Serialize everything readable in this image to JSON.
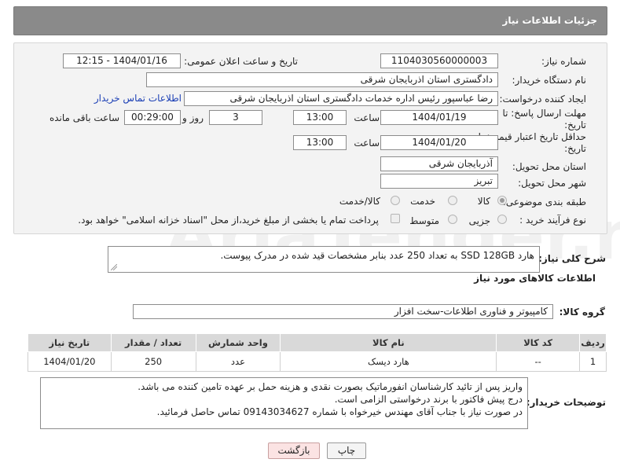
{
  "header": {
    "title": "جزئیات اطلاعات نیاز"
  },
  "form": {
    "need_number_label": "شماره نیاز:",
    "need_number": "1104030560000003",
    "announce_label": "تاریخ و ساعت اعلان عمومی:",
    "announce_value": "1404/01/16 - 12:15",
    "buyer_org_label": "نام دستگاه خریدار:",
    "buyer_org": "دادگستری استان اذربایجان شرقی",
    "creator_label": "ایجاد کننده درخواست:",
    "creator": "رضا عباسپور رئیس اداره خدمات دادگستری استان اذربایجان شرقی",
    "contact_link": "اطلاعات تماس خریدار",
    "deadline_label_1": "مهلت ارسال پاسخ: تا",
    "deadline_label_2": "تاریخ:",
    "deadline_date": "1404/01/19",
    "time_label": "ساعت",
    "deadline_time": "13:00",
    "days_value": "3",
    "days_label": "روز و",
    "remaining_time": "00:29:00",
    "remaining_label": "ساعت باقی مانده",
    "validity_label_1": "حداقل تاریخ اعتبار قیمت: تا",
    "validity_label_2": "تاریخ:",
    "validity_date": "1404/01/20",
    "validity_time": "13:00",
    "province_label": "استان محل تحویل:",
    "province": "آذربایجان شرقی",
    "city_label": "شهر محل تحویل:",
    "city": "تبریز",
    "category_label": "طبقه بندی موضوعی:",
    "category_options": [
      "کالا",
      "خدمت",
      "کالا/خدمت"
    ],
    "process_label": "نوع فرآیند خرید :",
    "process_options": [
      "جزیی",
      "متوسط"
    ],
    "payment_note": "پرداخت تمام یا بخشی از مبلغ خرید،از محل \"اسناد خزانه اسلامی\" خواهد بود."
  },
  "description": {
    "label": "شرح کلی نیاز:",
    "text": "هارد SSD 128GB به تعداد 250 عدد بنابر مشخصات قید شده در مدرک پیوست."
  },
  "goods": {
    "section_title": "اطلاعات کالاهای مورد نیاز",
    "group_label": "گروه کالا:",
    "group_value": "کامپیوتر و فناوری اطلاعات-سخت افزار",
    "columns": [
      "ردیف",
      "کد کالا",
      "نام کالا",
      "واحد شمارش",
      "تعداد / مقدار",
      "تاریخ نیاز"
    ],
    "rows": [
      [
        "1",
        "--",
        "هارد دیسک",
        "عدد",
        "250",
        "1404/01/20"
      ]
    ]
  },
  "buyer_notes": {
    "label": "توضیحات خریدار:",
    "lines": [
      "واریز پس از تائید کارشناسان انفورماتیک بصورت نقدی و هزینه حمل بر عهده تامین کننده می باشد.",
      "درج پیش فاکتور با برند درخواستی الزامی است.",
      "در صورت نیاز با جناب آقای مهندس خیرخواه با شماره 09143034627 تماس حاصل فرمائید."
    ]
  },
  "buttons": {
    "print": "چاپ",
    "back": "بازگشت"
  },
  "watermark": {
    "text": "AriaTender.neT"
  },
  "colors": {
    "header_bg": "#8a8a8a",
    "panel_bg": "#f3f3f3",
    "link": "#1b3fb5",
    "back_button_bg": "#fbe3e3"
  }
}
